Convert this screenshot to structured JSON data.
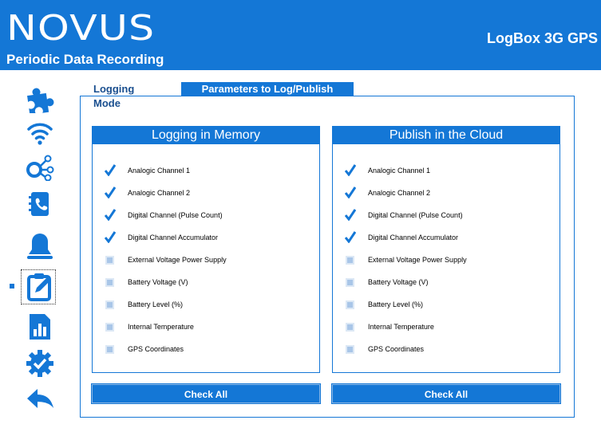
{
  "header": {
    "logo": "NOVUS",
    "subtitle": "Periodic Data Recording",
    "product": "LogBox 3G GPS"
  },
  "sidebar": {
    "items": [
      {
        "icon": "puzzle-icon"
      },
      {
        "icon": "wifi-icon"
      },
      {
        "icon": "network-icon"
      },
      {
        "icon": "contacts-book-icon"
      },
      {
        "icon": "bell-icon"
      },
      {
        "icon": "edit-clipboard-icon",
        "active": true
      },
      {
        "icon": "report-chart-icon"
      },
      {
        "icon": "gear-check-icon"
      },
      {
        "icon": "back-arrow-icon"
      }
    ]
  },
  "tabs": {
    "logging_mode": "Logging Mode",
    "parameters": "Parameters to Log/Publish"
  },
  "memory": {
    "title": "Logging in Memory",
    "check_all": "Check All",
    "items": [
      {
        "label": "Analogic Channel 1",
        "checked": true
      },
      {
        "label": "Analogic Channel 2",
        "checked": true
      },
      {
        "label": "Digital Channel (Pulse Count)",
        "checked": true
      },
      {
        "label": "Digital Channel Accumulator",
        "checked": true
      },
      {
        "label": "External Voltage Power Supply",
        "checked": false
      },
      {
        "label": "Battery Voltage (V)",
        "checked": false
      },
      {
        "label": "Battery Level (%)",
        "checked": false
      },
      {
        "label": "Internal Temperature",
        "checked": false
      },
      {
        "label": "GPS Coordinates",
        "checked": false
      }
    ]
  },
  "cloud": {
    "title": "Publish in the Cloud",
    "check_all": "Check All",
    "items": [
      {
        "label": "Analogic Channel 1",
        "checked": true
      },
      {
        "label": "Analogic Channel 2",
        "checked": true
      },
      {
        "label": "Digital Channel (Pulse Count)",
        "checked": true
      },
      {
        "label": "Digital Channel Accumulator",
        "checked": true
      },
      {
        "label": "External Voltage Power Supply",
        "checked": false
      },
      {
        "label": "Battery Voltage (V)",
        "checked": false
      },
      {
        "label": "Battery Level (%)",
        "checked": false
      },
      {
        "label": "Internal Temperature",
        "checked": false
      },
      {
        "label": "GPS Coordinates",
        "checked": false
      }
    ]
  },
  "colors": {
    "brand_blue": "#1477d6",
    "tab_text": "#1a4f8f"
  }
}
